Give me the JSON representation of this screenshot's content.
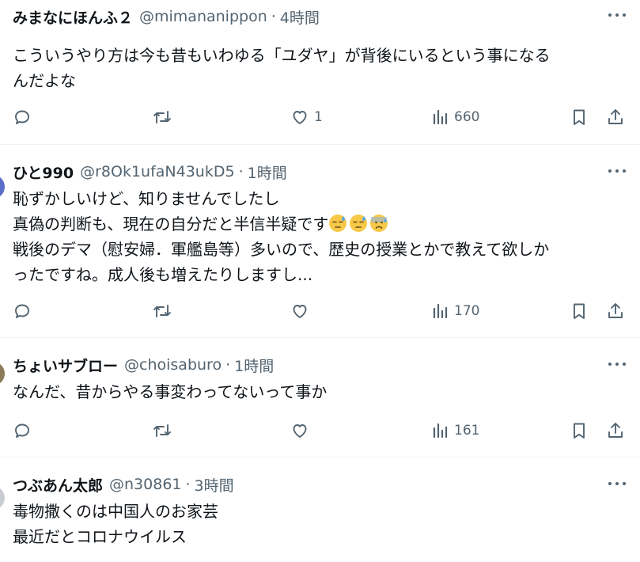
{
  "tweets": [
    {
      "name": "みまなにほんふ２",
      "handle": "@mimananippon",
      "time": "4時間",
      "lines": [
        "こういうやり方は今も昔もいわゆる「ユダヤ」が背後にいるという事になる",
        "んだよな"
      ],
      "likes": "1",
      "views": "660"
    },
    {
      "name": "ひと990",
      "handle": "@r8Ok1ufaN43ukD5",
      "time": "1時間",
      "lines": [
        "恥ずかしいけど、知りませんでしたし",
        "真偽の判断も、現在の自分だと半信半疑です",
        "戦後のデマ（慰安婦．軍艦島等）多いので、歴史の授業とかで教えて欲しか",
        "ったですね。成人後も増えたりしますし..."
      ],
      "likes": "",
      "views": "170"
    },
    {
      "name": "ちょいサブロー",
      "handle": "@choisaburo",
      "time": "1時間",
      "lines": [
        "なんだ、昔からやる事変わってないって事か"
      ],
      "likes": "",
      "views": "161"
    },
    {
      "name": "つぶあん太郎",
      "handle": "@n30861",
      "time": "3時間",
      "lines": [
        "毒物撒くのは中国人のお家芸",
        "最近だとコロナウイルス"
      ]
    }
  ],
  "separator": "·",
  "colors": {
    "text": "#0f1419",
    "muted": "#536471",
    "divider": "#eff3f4",
    "emoji": "#f7c948",
    "sweat": "#5aa6e6"
  },
  "icons": [
    "reply-icon",
    "retweet-icon",
    "like-icon",
    "views-icon",
    "bookmark-icon",
    "share-icon",
    "more-icon",
    "downcast-sweat-face-icon",
    "anxious-sweat-face-icon"
  ]
}
